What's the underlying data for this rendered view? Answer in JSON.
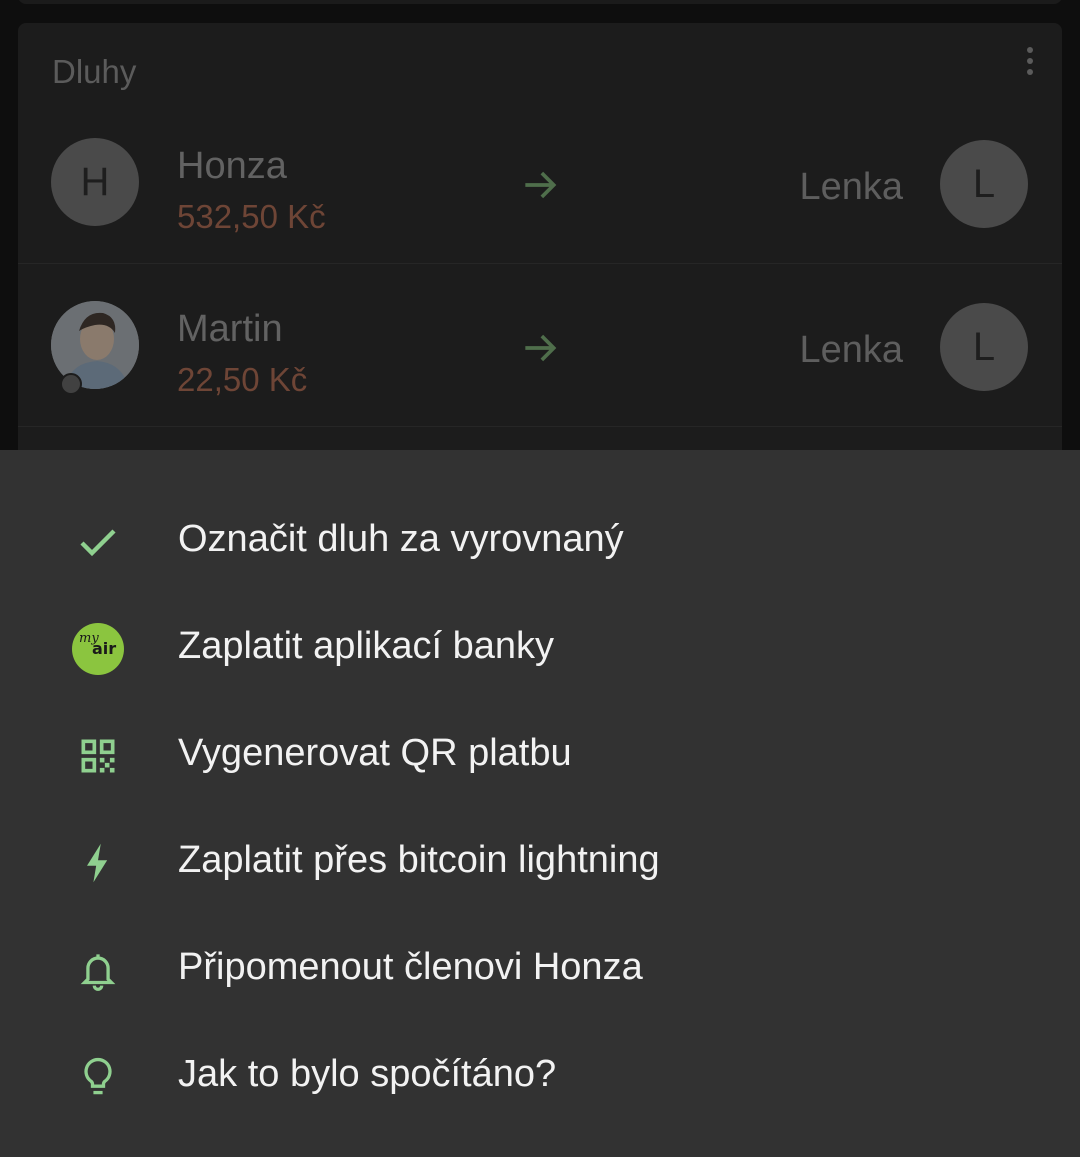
{
  "debts_card": {
    "title": "Dluhy",
    "rows": [
      {
        "from_initial": "H",
        "from_name": "Honza",
        "amount": "532,50 Kč",
        "to_name": "Lenka",
        "to_initial": "L"
      },
      {
        "from_initial": "",
        "from_name": "Martin",
        "amount": "22,50 Kč",
        "to_name": "Lenka",
        "to_initial": "L"
      }
    ]
  },
  "sheet": {
    "items": [
      {
        "label": "Označit dluh za vyrovnaný",
        "icon": "check-icon"
      },
      {
        "label": "Zaplatit aplikací banky",
        "icon": "myair-logo-icon"
      },
      {
        "label": "Vygenerovat QR platbu",
        "icon": "qr-code-icon"
      },
      {
        "label": "Zaplatit přes bitcoin lightning",
        "icon": "lightning-icon"
      },
      {
        "label": "Připomenout členovi Honza",
        "icon": "bell-icon"
      },
      {
        "label": "Jak to bylo spočítáno?",
        "icon": "lightbulb-icon"
      }
    ]
  },
  "colors": {
    "accent_green": "#8fd08f",
    "amount_owed": "#6e4536",
    "sheet_bg": "#323232",
    "myair_green": "#8bc53f"
  }
}
